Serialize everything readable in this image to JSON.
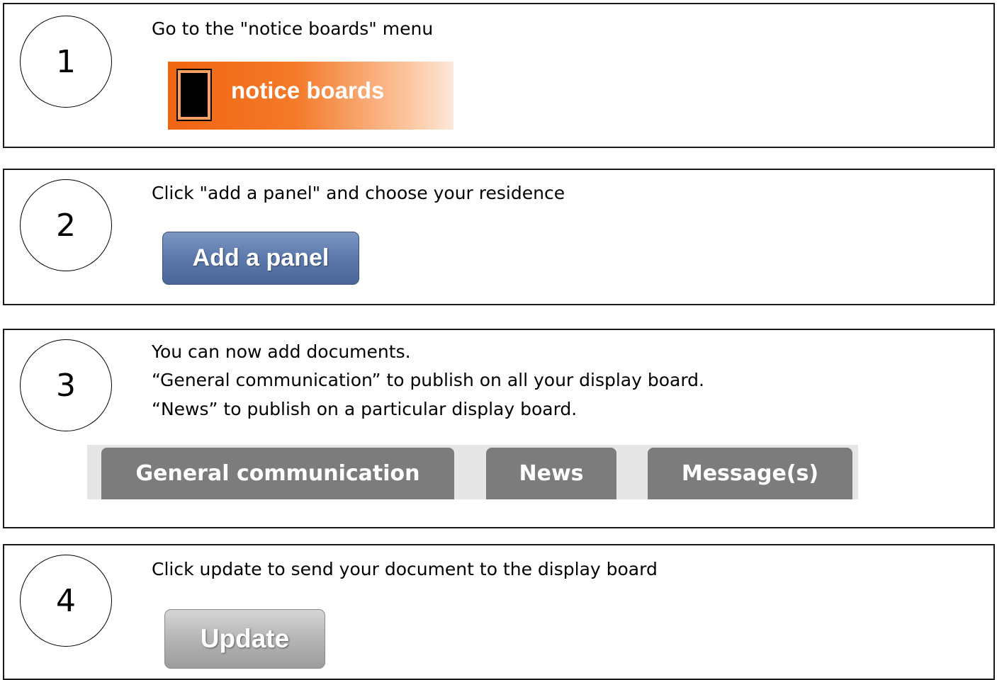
{
  "steps": [
    {
      "number": "1",
      "text": "Go to the \"notice boards\" menu",
      "button_label": "notice boards"
    },
    {
      "number": "2",
      "text": "Click \"add a panel\" and choose your residence",
      "button_label": "Add a panel"
    },
    {
      "number": "3",
      "lines": [
        "You can now add documents.",
        "“General communication” to publish on all your display board.",
        "“News” to publish on a particular display board."
      ],
      "tabs": [
        "General communication",
        "News",
        "Message(s)"
      ]
    },
    {
      "number": "4",
      "text": "Click update to send your document to the display board",
      "button_label": "Update"
    }
  ],
  "colors": {
    "notice_orange": "#f06410",
    "add_panel_blue": "#5b78ab",
    "tab_gray": "#7c7c7c",
    "update_gray": "#b8b8b8"
  }
}
